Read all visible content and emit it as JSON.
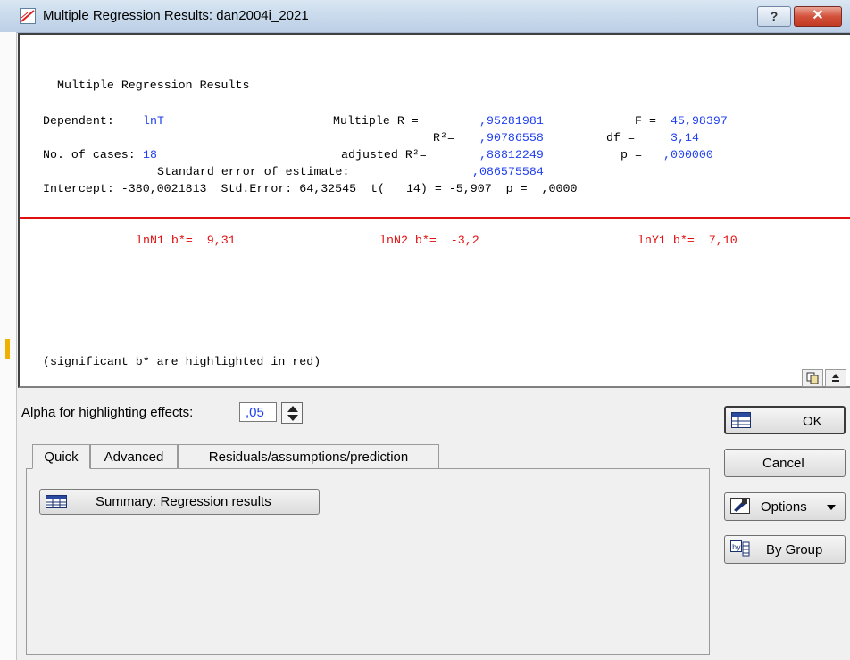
{
  "window": {
    "title": "Multiple Regression Results: dan2004i_2021",
    "help_label": "?",
    "close_label": "✕"
  },
  "results": {
    "heading": "Multiple Regression Results",
    "dependent_label": "Dependent:",
    "dependent_value": "lnT",
    "multiple_r_label": "Multiple R =",
    "multiple_r_value": ",95281981",
    "f_label": "F =",
    "f_value": "45,98397",
    "r2_label": "R²=",
    "r2_value": ",90786558",
    "df_label": "df =",
    "df_value": "3,14",
    "cases_label": "No. of cases:",
    "cases_value": "18",
    "adj_r2_label": "adjusted R²=",
    "adj_r2_value": ",88812249",
    "p_label": "p =",
    "p_value": ",000000",
    "se_label": "Standard error of estimate:",
    "se_value": ",086575584",
    "intercept_line": "Intercept: -380,0021813  Std.Error: 64,32545  t(   14) = -5,907  p =  ,0000",
    "coefficients": [
      {
        "text": "lnN1 b*=  9,31"
      },
      {
        "text": "lnN2 b*=  -3,2"
      },
      {
        "text": "lnY1 b*=  7,10"
      }
    ],
    "footnote": "(significant b* are highlighted in red)"
  },
  "controls": {
    "alpha_label": "Alpha for highlighting effects:",
    "alpha_value": ",05",
    "tabs": [
      {
        "label": "Quick"
      },
      {
        "label": "Advanced"
      },
      {
        "label": "Residuals/assumptions/prediction"
      }
    ],
    "summary_button": "Summary:  Regression results",
    "ok": "OK",
    "cancel": "Cancel",
    "options": "Options",
    "by_group": "By Group"
  },
  "colors": {
    "value_blue": "#1f3ff0",
    "highlight_red": "#e01010"
  }
}
